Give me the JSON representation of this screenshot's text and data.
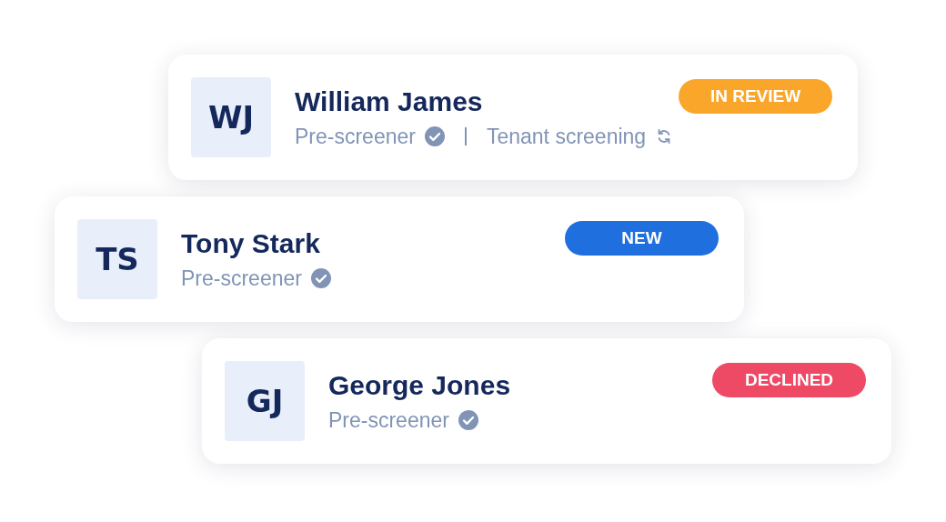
{
  "applicants": [
    {
      "initials": "WJ",
      "name": "William James",
      "badge": {
        "label": "IN REVIEW",
        "color": "#f9a62a"
      },
      "steps": [
        {
          "label": "Pre-screener",
          "done": true
        },
        {
          "label": "Tenant screening",
          "done": false
        }
      ]
    },
    {
      "initials": "TS",
      "name": "Tony Stark",
      "badge": {
        "label": "NEW",
        "color": "#1f6fde"
      },
      "steps": [
        {
          "label": "Pre-screener",
          "done": true
        }
      ]
    },
    {
      "initials": "GJ",
      "name": "George Jones",
      "badge": {
        "label": "DECLINED",
        "color": "#ee4a66"
      },
      "steps": [
        {
          "label": "Pre-screener",
          "done": true
        }
      ]
    }
  ]
}
